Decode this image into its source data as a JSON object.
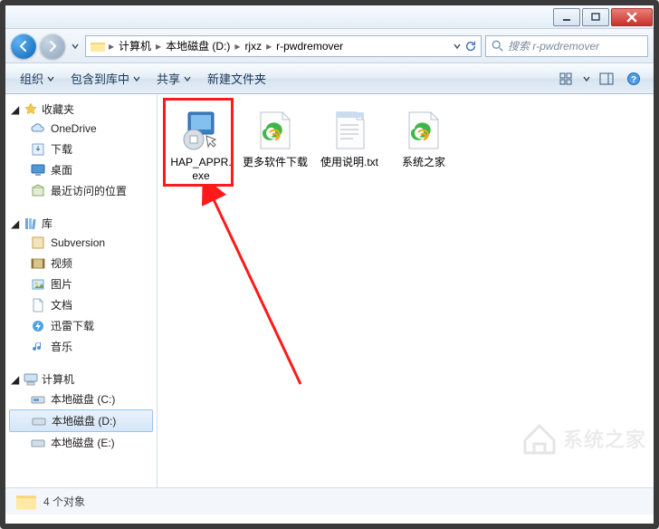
{
  "window": {
    "min_tip": "最小化",
    "max_tip": "最大化",
    "close_tip": "关闭"
  },
  "nav": {
    "back_tip": "后退",
    "forward_tip": "前进"
  },
  "breadcrumb": {
    "computer": "计算机",
    "drive": "本地磁盘 (D:)",
    "folder1": "rjxz",
    "folder2": "r-pwdremover"
  },
  "search": {
    "placeholder": "搜索 r-pwdremover"
  },
  "toolbar": {
    "organize": "组织",
    "include": "包含到库中",
    "share": "共享",
    "newfolder": "新建文件夹"
  },
  "sidebar": {
    "favorites": "收藏夹",
    "favorites_items": {
      "onedrive": "OneDrive",
      "downloads": "下载",
      "desktop": "桌面",
      "recent": "最近访问的位置"
    },
    "libraries": "库",
    "libraries_items": {
      "subversion": "Subversion",
      "videos": "视频",
      "pictures": "图片",
      "documents": "文档",
      "xunlei": "迅雷下载",
      "music": "音乐"
    },
    "computer": "计算机",
    "computer_items": {
      "drive_c": "本地磁盘 (C:)",
      "drive_d": "本地磁盘 (D:)",
      "drive_e": "本地磁盘 (E:)"
    }
  },
  "files": [
    {
      "name": "HAP_APPR.exe",
      "type": "exe"
    },
    {
      "name": "更多软件下载",
      "type": "url"
    },
    {
      "name": "使用说明.txt",
      "type": "txt"
    },
    {
      "name": "系统之家",
      "type": "url"
    }
  ],
  "status": {
    "count_text": "4 个对象"
  },
  "watermark": {
    "text": "系统之家"
  }
}
